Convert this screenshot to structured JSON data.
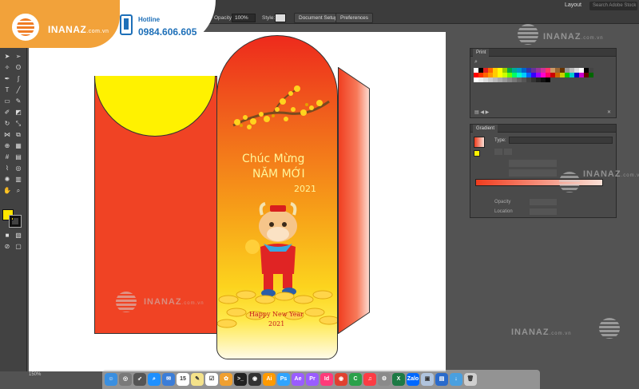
{
  "window": {
    "app_short": "Ai",
    "layout_label": "Layout",
    "search_placeholder": "Search Adobe Stock"
  },
  "control_bar": {
    "opacity_label": "Opacity:",
    "opacity_value": "100%",
    "style_label": "Style:",
    "document_setup": "Document Setup",
    "preferences": "Preferences"
  },
  "brand": {
    "name": "INANAZ",
    "domain": ".com.vn",
    "hotline_label": "Hotline",
    "hotline_number": "0984.606.605",
    "accent": "#f2a23a",
    "blue": "#1d6fb8"
  },
  "envelope": {
    "greeting_line1": "Chúc Mừng",
    "greeting_line2": "NĂM MỚI",
    "year": "2021",
    "footer_line1": "Happy New Year",
    "footer_line2": "2021",
    "colors": {
      "red": "#f04324",
      "yellow": "#fff200"
    }
  },
  "panels": {
    "swatches_title": "Print",
    "gradient_title": "Gradient",
    "gradient_type_label": "Type:",
    "opacity_label": "Opacity",
    "location_label": "Location"
  },
  "status_bar": {
    "zoom": "150%"
  },
  "dock": {
    "apps": [
      "Finder",
      "Launchpad",
      "Rocket",
      "Safari",
      "Mail",
      "Calendar",
      "Notes",
      "Reminders",
      "Photos",
      "Terminal",
      "Photoshop Camera",
      "Illustrator",
      "Photoshop",
      "After Effects",
      "Premiere",
      "InDesign",
      "Chrome",
      "Camtasia",
      "iTunes",
      "Settings",
      "Excel",
      "Zalo",
      "Preview",
      "Docs",
      "Downloads",
      "Trash"
    ]
  },
  "watermark": {
    "text": "INANAZ",
    "domain": ".com.vn"
  }
}
